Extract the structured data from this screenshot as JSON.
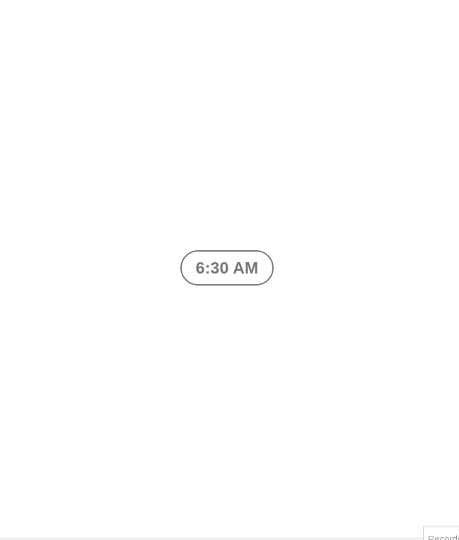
{
  "clock": {
    "time_label": "6:30 AM",
    "border_color": "#7d7d7d",
    "text_color": "#767676"
  },
  "recorder": {
    "label": "Recorder"
  }
}
